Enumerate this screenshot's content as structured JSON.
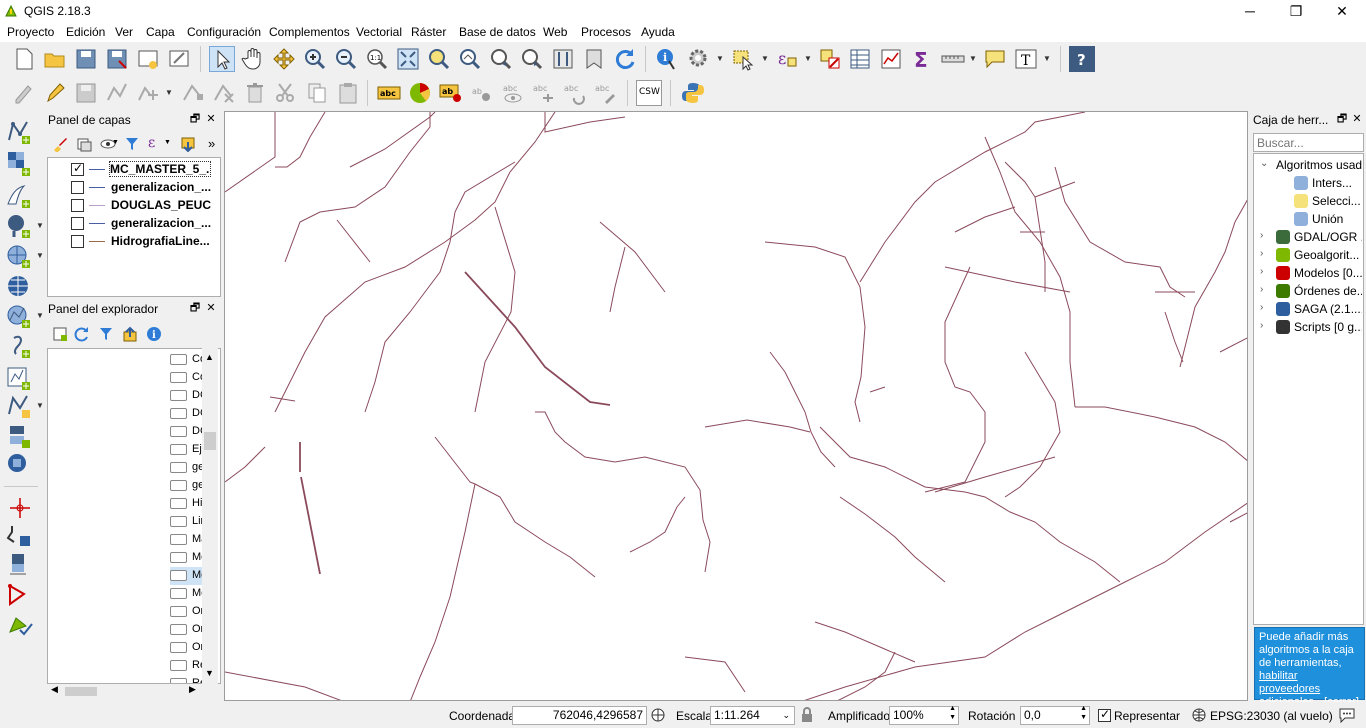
{
  "window": {
    "title": "QGIS 2.18.3"
  },
  "menu": [
    "Proyecto",
    "Edición",
    "Ver",
    "Capa",
    "Configuración",
    "Complementos",
    "Vectorial",
    "Ráster",
    "Base de datos",
    "Web",
    "Procesos",
    "Ayuda"
  ],
  "layers_panel": {
    "title": "Panel de capas",
    "layers": [
      {
        "name": "MC_MASTER_5_...",
        "checked": true,
        "selected": true
      },
      {
        "name": "generalizacion_...",
        "checked": false
      },
      {
        "name": "DOUGLAS_PEUC...",
        "checked": false
      },
      {
        "name": "generalizacion_...",
        "checked": false
      },
      {
        "name": "HidrografiaLine...",
        "checked": false
      }
    ]
  },
  "browser_panel": {
    "title": "Panel del explorador",
    "items": [
      "Co",
      "Co",
      "DC",
      "DC",
      "DC",
      "Ej",
      "ge",
      "ge",
      "Hi",
      "Lin",
      "Ma",
      "Mc",
      "Mc",
      "Mc",
      "Or",
      "Or",
      "Or",
      "Re",
      "Re"
    ]
  },
  "toolbox": {
    "title": "Caja de herr...",
    "search_placeholder": "Buscar...",
    "tree": [
      {
        "label": "Algoritmos usad...",
        "expanded": true,
        "level": 0
      },
      {
        "label": "Inters...",
        "level": 1
      },
      {
        "label": "Selecci...",
        "level": 1
      },
      {
        "label": "Unión",
        "level": 1
      },
      {
        "label": "GDAL/OGR ...",
        "level": 0
      },
      {
        "label": "Geoalgorit...",
        "level": 0
      },
      {
        "label": "Modelos [0...",
        "level": 0
      },
      {
        "label": "Órdenes de...",
        "level": 0
      },
      {
        "label": "SAGA (2.1....",
        "level": 0
      },
      {
        "label": "Scripts [0 g...",
        "level": 0
      }
    ],
    "info": {
      "text": "Puede añadir más algoritmos a la caja de herramientas,",
      "link": "habilitar proveedores adicionales.",
      "close": "[cerrar]"
    }
  },
  "statusbar": {
    "coord_label": "Coordenada",
    "coord_value": "762046,4296587",
    "scale_label": "Escala",
    "scale_value": "1:11.264",
    "magnifier_label": "Amplificador",
    "magnifier_value": "100%",
    "rotation_label": "Rotación",
    "rotation_value": "0,0",
    "render_label": "Representar",
    "render_checked": true,
    "crs": "EPSG:23030 (al vuelo)"
  },
  "toolbar": {
    "csw_label": "CSW"
  },
  "colors": {
    "line": "#8b4a5c",
    "accent": "#1e90dc"
  }
}
